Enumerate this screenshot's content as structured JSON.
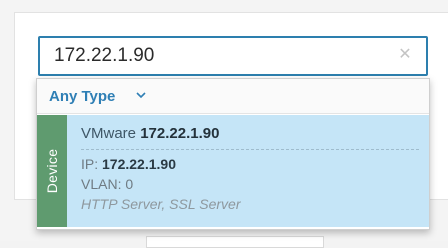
{
  "search": {
    "value": "172.22.1.90",
    "clear_icon": "close-icon"
  },
  "filter": {
    "label": "Any Type",
    "icon": "chevron-down-icon",
    "accent": "#2f7fb5"
  },
  "results": [
    {
      "category": "Device",
      "category_color": "#5f9b6f",
      "title_prefix": "VMware",
      "title_value": "172.22.1.90",
      "ip_label": "IP:",
      "ip_value": "172.22.1.90",
      "vlan": "VLAN: 0",
      "services": "HTTP Server, SSL Server",
      "highlight": "#c5e5f7"
    }
  ],
  "colors": {
    "input_border": "#2d7fae"
  }
}
